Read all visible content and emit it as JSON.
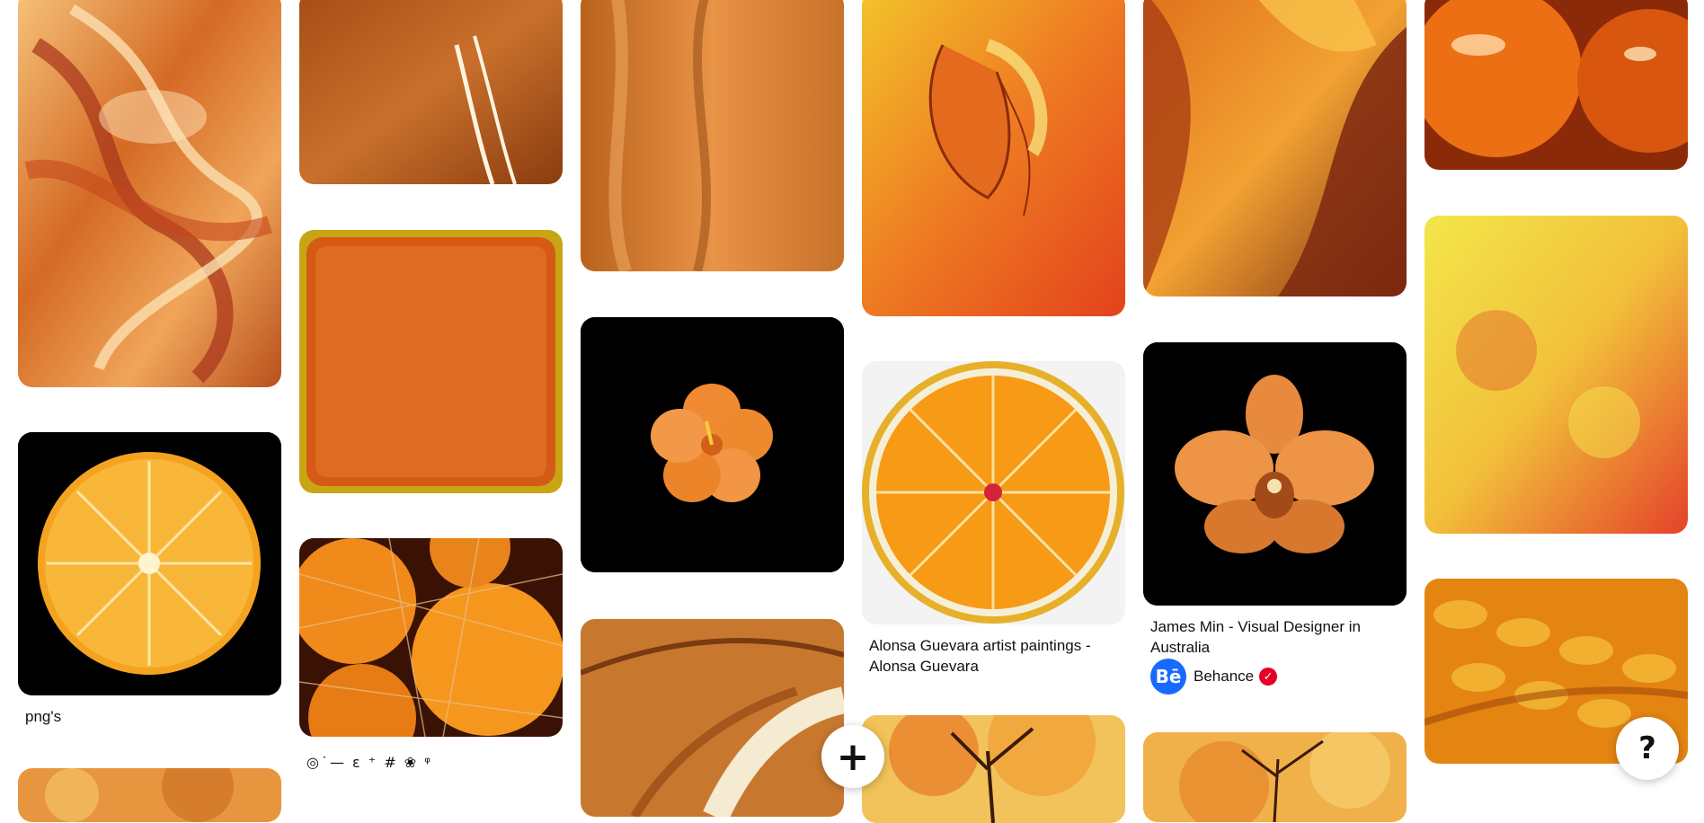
{
  "pins": [
    {
      "id": "c1a",
      "label": "",
      "alt_icon": "abstract-swirl-painting"
    },
    {
      "id": "c1b",
      "label": "png's",
      "alt_icon": "orange-slice-black-bg"
    },
    {
      "id": "c1c",
      "label": "",
      "alt_icon": "autumn-trees"
    },
    {
      "id": "c2a",
      "label": "",
      "alt_icon": "glossy-orange-swatch"
    },
    {
      "id": "c2b",
      "label": "",
      "alt_icon": "orange-eyeshadow-pan"
    },
    {
      "id": "c2c",
      "label": "",
      "alt_icon": "oranges-in-net"
    },
    {
      "id": "c3a",
      "label": "",
      "alt_icon": "orange-fur"
    },
    {
      "id": "c3b",
      "label": "",
      "alt_icon": "orange-hibiscus"
    },
    {
      "id": "c3c",
      "label": "",
      "alt_icon": "butterfly-wing"
    },
    {
      "id": "c4a",
      "label": "",
      "alt_icon": "jellyfish-orange"
    },
    {
      "id": "c4b",
      "label": "Alonsa Guevara artist paintings - Alonsa Guevara",
      "alt_icon": "orange-slice-white-bg"
    },
    {
      "id": "c4c",
      "label": "",
      "alt_icon": "autumn-tree-painting"
    },
    {
      "id": "c5a",
      "label": "",
      "alt_icon": "antelope-canyon"
    },
    {
      "id": "c5b",
      "label": "James Min - Visual Designer in Australia",
      "alt_icon": "orange-orchid"
    },
    {
      "id": "c5c",
      "label": "",
      "alt_icon": "autumn-illustration"
    },
    {
      "id": "c6a",
      "label": "",
      "alt_icon": "orange-glass-spheres"
    },
    {
      "id": "c6b",
      "label": "",
      "alt_icon": "yellow-red-gradient"
    },
    {
      "id": "c6c",
      "label": "",
      "alt_icon": "orange-scales"
    }
  ],
  "c1b_title": "png's",
  "c2c_symbols": "◎˙— ɛ ⁺  # ❀   ᵠ",
  "c4b_title": "Alonsa Guevara artist paintings - Alonsa Guevara",
  "c5b_title": "James Min - Visual Designer in Australia",
  "c5b_source": {
    "avatar_text": "Bē",
    "name": "Behance",
    "verified_icon": "check-badge-icon",
    "verified_color": "#e60023"
  },
  "fab_create": {
    "label": "+",
    "icon": "plus-icon"
  },
  "fab_help": {
    "label": "?",
    "icon": "help-icon"
  },
  "colors": {
    "accent_red": "#e60023",
    "behance_blue": "#1769ff",
    "background": "#ffffff"
  }
}
